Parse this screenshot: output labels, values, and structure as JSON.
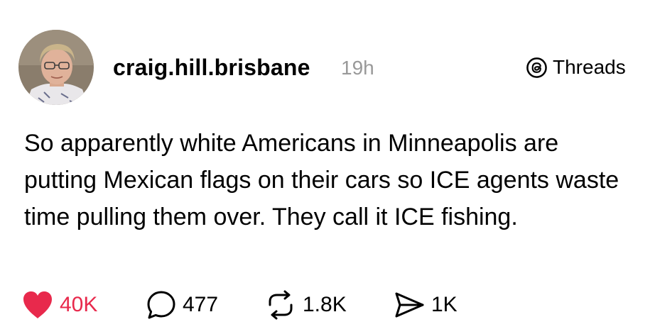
{
  "post": {
    "author": {
      "username": "craig.hill.brisbane",
      "timestamp": "19h"
    },
    "brand": {
      "label": "Threads",
      "icon": "threads-logo-icon"
    },
    "text": "So apparently white Americans in Minneapolis are putting Mexican flags on their cars so ICE agents waste time pulling them over. They call it ICE fishing.",
    "actions": {
      "like": {
        "icon": "heart-icon",
        "count": "40K",
        "liked": true,
        "color": "#e8294c"
      },
      "reply": {
        "icon": "comment-bubble-icon",
        "count": "477"
      },
      "repost": {
        "icon": "repost-icon",
        "count": "1.8K"
      },
      "share": {
        "icon": "send-icon",
        "count": "1K"
      }
    }
  }
}
